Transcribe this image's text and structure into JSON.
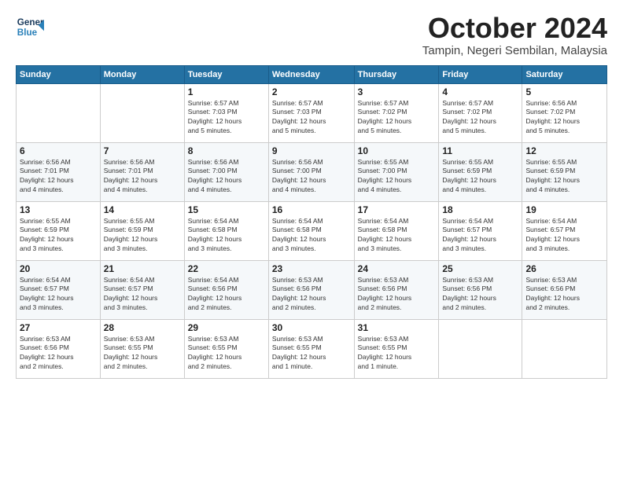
{
  "logo": {
    "line1": "General",
    "line2": "Blue"
  },
  "title": "October 2024",
  "location": "Tampin, Negeri Sembilan, Malaysia",
  "headers": [
    "Sunday",
    "Monday",
    "Tuesday",
    "Wednesday",
    "Thursday",
    "Friday",
    "Saturday"
  ],
  "weeks": [
    [
      {
        "day": "",
        "info": ""
      },
      {
        "day": "",
        "info": ""
      },
      {
        "day": "1",
        "info": "Sunrise: 6:57 AM\nSunset: 7:03 PM\nDaylight: 12 hours\nand 5 minutes."
      },
      {
        "day": "2",
        "info": "Sunrise: 6:57 AM\nSunset: 7:03 PM\nDaylight: 12 hours\nand 5 minutes."
      },
      {
        "day": "3",
        "info": "Sunrise: 6:57 AM\nSunset: 7:02 PM\nDaylight: 12 hours\nand 5 minutes."
      },
      {
        "day": "4",
        "info": "Sunrise: 6:57 AM\nSunset: 7:02 PM\nDaylight: 12 hours\nand 5 minutes."
      },
      {
        "day": "5",
        "info": "Sunrise: 6:56 AM\nSunset: 7:02 PM\nDaylight: 12 hours\nand 5 minutes."
      }
    ],
    [
      {
        "day": "6",
        "info": "Sunrise: 6:56 AM\nSunset: 7:01 PM\nDaylight: 12 hours\nand 4 minutes."
      },
      {
        "day": "7",
        "info": "Sunrise: 6:56 AM\nSunset: 7:01 PM\nDaylight: 12 hours\nand 4 minutes."
      },
      {
        "day": "8",
        "info": "Sunrise: 6:56 AM\nSunset: 7:00 PM\nDaylight: 12 hours\nand 4 minutes."
      },
      {
        "day": "9",
        "info": "Sunrise: 6:56 AM\nSunset: 7:00 PM\nDaylight: 12 hours\nand 4 minutes."
      },
      {
        "day": "10",
        "info": "Sunrise: 6:55 AM\nSunset: 7:00 PM\nDaylight: 12 hours\nand 4 minutes."
      },
      {
        "day": "11",
        "info": "Sunrise: 6:55 AM\nSunset: 6:59 PM\nDaylight: 12 hours\nand 4 minutes."
      },
      {
        "day": "12",
        "info": "Sunrise: 6:55 AM\nSunset: 6:59 PM\nDaylight: 12 hours\nand 4 minutes."
      }
    ],
    [
      {
        "day": "13",
        "info": "Sunrise: 6:55 AM\nSunset: 6:59 PM\nDaylight: 12 hours\nand 3 minutes."
      },
      {
        "day": "14",
        "info": "Sunrise: 6:55 AM\nSunset: 6:59 PM\nDaylight: 12 hours\nand 3 minutes."
      },
      {
        "day": "15",
        "info": "Sunrise: 6:54 AM\nSunset: 6:58 PM\nDaylight: 12 hours\nand 3 minutes."
      },
      {
        "day": "16",
        "info": "Sunrise: 6:54 AM\nSunset: 6:58 PM\nDaylight: 12 hours\nand 3 minutes."
      },
      {
        "day": "17",
        "info": "Sunrise: 6:54 AM\nSunset: 6:58 PM\nDaylight: 12 hours\nand 3 minutes."
      },
      {
        "day": "18",
        "info": "Sunrise: 6:54 AM\nSunset: 6:57 PM\nDaylight: 12 hours\nand 3 minutes."
      },
      {
        "day": "19",
        "info": "Sunrise: 6:54 AM\nSunset: 6:57 PM\nDaylight: 12 hours\nand 3 minutes."
      }
    ],
    [
      {
        "day": "20",
        "info": "Sunrise: 6:54 AM\nSunset: 6:57 PM\nDaylight: 12 hours\nand 3 minutes."
      },
      {
        "day": "21",
        "info": "Sunrise: 6:54 AM\nSunset: 6:57 PM\nDaylight: 12 hours\nand 3 minutes."
      },
      {
        "day": "22",
        "info": "Sunrise: 6:54 AM\nSunset: 6:56 PM\nDaylight: 12 hours\nand 2 minutes."
      },
      {
        "day": "23",
        "info": "Sunrise: 6:53 AM\nSunset: 6:56 PM\nDaylight: 12 hours\nand 2 minutes."
      },
      {
        "day": "24",
        "info": "Sunrise: 6:53 AM\nSunset: 6:56 PM\nDaylight: 12 hours\nand 2 minutes."
      },
      {
        "day": "25",
        "info": "Sunrise: 6:53 AM\nSunset: 6:56 PM\nDaylight: 12 hours\nand 2 minutes."
      },
      {
        "day": "26",
        "info": "Sunrise: 6:53 AM\nSunset: 6:56 PM\nDaylight: 12 hours\nand 2 minutes."
      }
    ],
    [
      {
        "day": "27",
        "info": "Sunrise: 6:53 AM\nSunset: 6:56 PM\nDaylight: 12 hours\nand 2 minutes."
      },
      {
        "day": "28",
        "info": "Sunrise: 6:53 AM\nSunset: 6:55 PM\nDaylight: 12 hours\nand 2 minutes."
      },
      {
        "day": "29",
        "info": "Sunrise: 6:53 AM\nSunset: 6:55 PM\nDaylight: 12 hours\nand 2 minutes."
      },
      {
        "day": "30",
        "info": "Sunrise: 6:53 AM\nSunset: 6:55 PM\nDaylight: 12 hours\nand 1 minute."
      },
      {
        "day": "31",
        "info": "Sunrise: 6:53 AM\nSunset: 6:55 PM\nDaylight: 12 hours\nand 1 minute."
      },
      {
        "day": "",
        "info": ""
      },
      {
        "day": "",
        "info": ""
      }
    ]
  ]
}
